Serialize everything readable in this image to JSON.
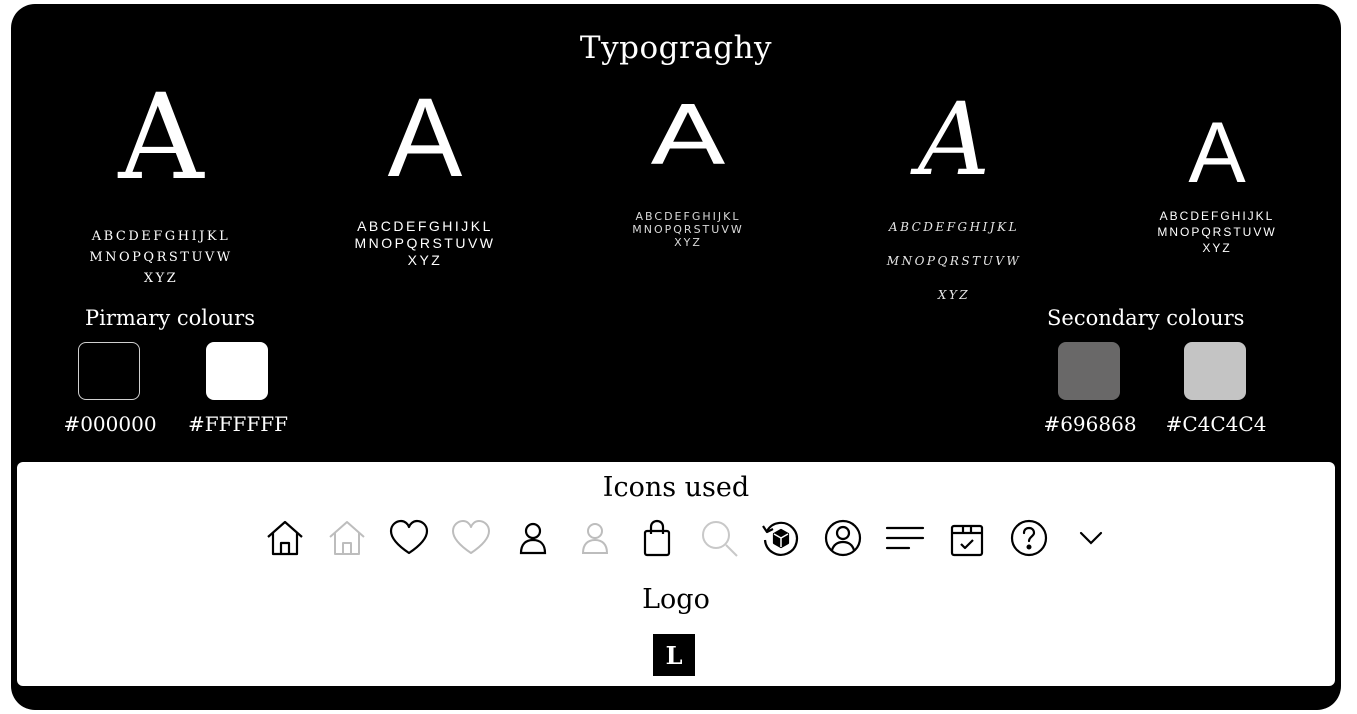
{
  "typography": {
    "title": "Typograghy",
    "specimens": [
      {
        "letter": "A",
        "lines": [
          "ABCDEFGHIJKL",
          "MNOPQRSTUVW",
          "XYZ"
        ]
      },
      {
        "letter": "A",
        "lines": [
          "ABCDEFGHIJKL",
          "MNOPQRSTUVW",
          "XYZ"
        ]
      },
      {
        "letter": "A",
        "lines": [
          "ABCDEFGHIJKL",
          "MNOPQRSTUVW",
          "XYZ"
        ]
      },
      {
        "letter": "A",
        "lines": [
          "ABCDEFGHIJKL",
          "MNOPQRSTUVW",
          "XYZ"
        ]
      },
      {
        "letter": "A",
        "lines": [
          "ABCDEFGHIJKL",
          "MNOPQRSTUVW",
          "XYZ"
        ]
      }
    ]
  },
  "colours": {
    "primary_label": "Pirmary colours",
    "secondary_label": "Secondary colours",
    "primary": [
      {
        "hex": "#000000",
        "label": "#000000"
      },
      {
        "hex": "#FFFFFF",
        "label": "#FFFFFF"
      }
    ],
    "secondary": [
      {
        "hex": "#696868",
        "label": "#696868"
      },
      {
        "hex": "#C4C4C4",
        "label": "#C4C4C4"
      }
    ]
  },
  "icons": {
    "title": "Icons used",
    "items": [
      "home-icon",
      "home-outline-light-icon",
      "heart-icon",
      "heart-light-icon",
      "user-icon",
      "user-light-icon",
      "shopping-bag-icon",
      "search-light-icon",
      "return-box-icon",
      "account-circle-icon",
      "menu-lines-icon",
      "delivery-box-icon",
      "help-circle-icon",
      "chevron-down-icon"
    ]
  },
  "logo": {
    "title": "Logo",
    "mark": "L"
  }
}
